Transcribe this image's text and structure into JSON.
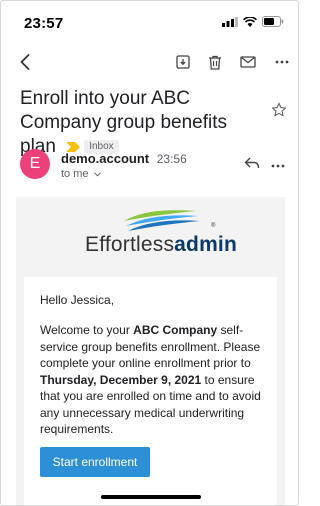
{
  "status_bar": {
    "time": "23:57"
  },
  "toolbar": {
    "back_icon": "back-arrow-icon",
    "archive_icon": "archive-icon",
    "delete_icon": "trash-icon",
    "mark_unread_icon": "mail-icon",
    "more_icon": "more-horizontal-icon"
  },
  "subject": {
    "title": "Enroll into your ABC Company group benefits plan",
    "label": "Inbox",
    "label_color": "#f9c00b"
  },
  "sender": {
    "initial": "E",
    "name": "demo.account",
    "time": "23:56",
    "recipient": "to me",
    "avatar_color": "#ec407a"
  },
  "email": {
    "logo_light": "Effortless",
    "logo_bold": "admin",
    "logo_reg": "®",
    "greeting": "Hello Jessica,",
    "p1": "Welcome to your ",
    "company": "ABC Company",
    "p2": " self-service group benefits enrollment. Please complete your online enrollment prior to ",
    "deadline": "Thursday, December 9, 2021",
    "p3": " to ensure that you are enrolled on time and to avoid any unnecessary medical underwriting requirements.",
    "cta_label": "Start enrollment",
    "cta_color": "#2d8fd5"
  }
}
